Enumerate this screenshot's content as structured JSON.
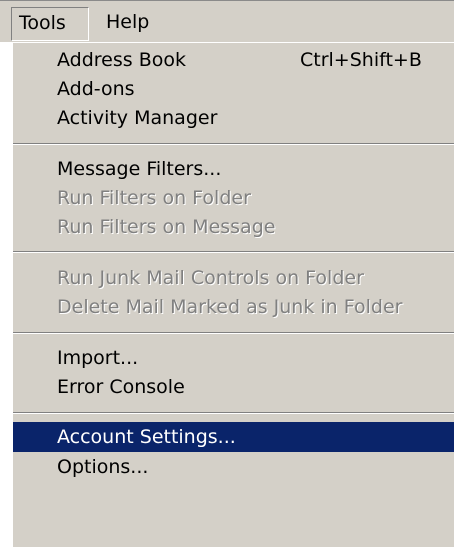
{
  "colors": {
    "menu_bg": "#d4d0c8",
    "highlight": "#0a246a",
    "disabled_text": "#808080"
  },
  "menubar": {
    "tools_label": "Tools",
    "help_label": "Help"
  },
  "menu": {
    "address_book": {
      "label": "Address Book",
      "shortcut": "Ctrl+Shift+B"
    },
    "add_ons": "Add-ons",
    "activity_manager": "Activity Manager",
    "message_filters": "Message Filters...",
    "run_filters_folder": "Run Filters on Folder",
    "run_filters_message": "Run Filters on Message",
    "run_junk_controls": "Run Junk Mail Controls on Folder",
    "delete_junk": "Delete Mail Marked as Junk in Folder",
    "import": "Import...",
    "error_console": "Error Console",
    "account_settings": "Account Settings...",
    "options": "Options..."
  }
}
